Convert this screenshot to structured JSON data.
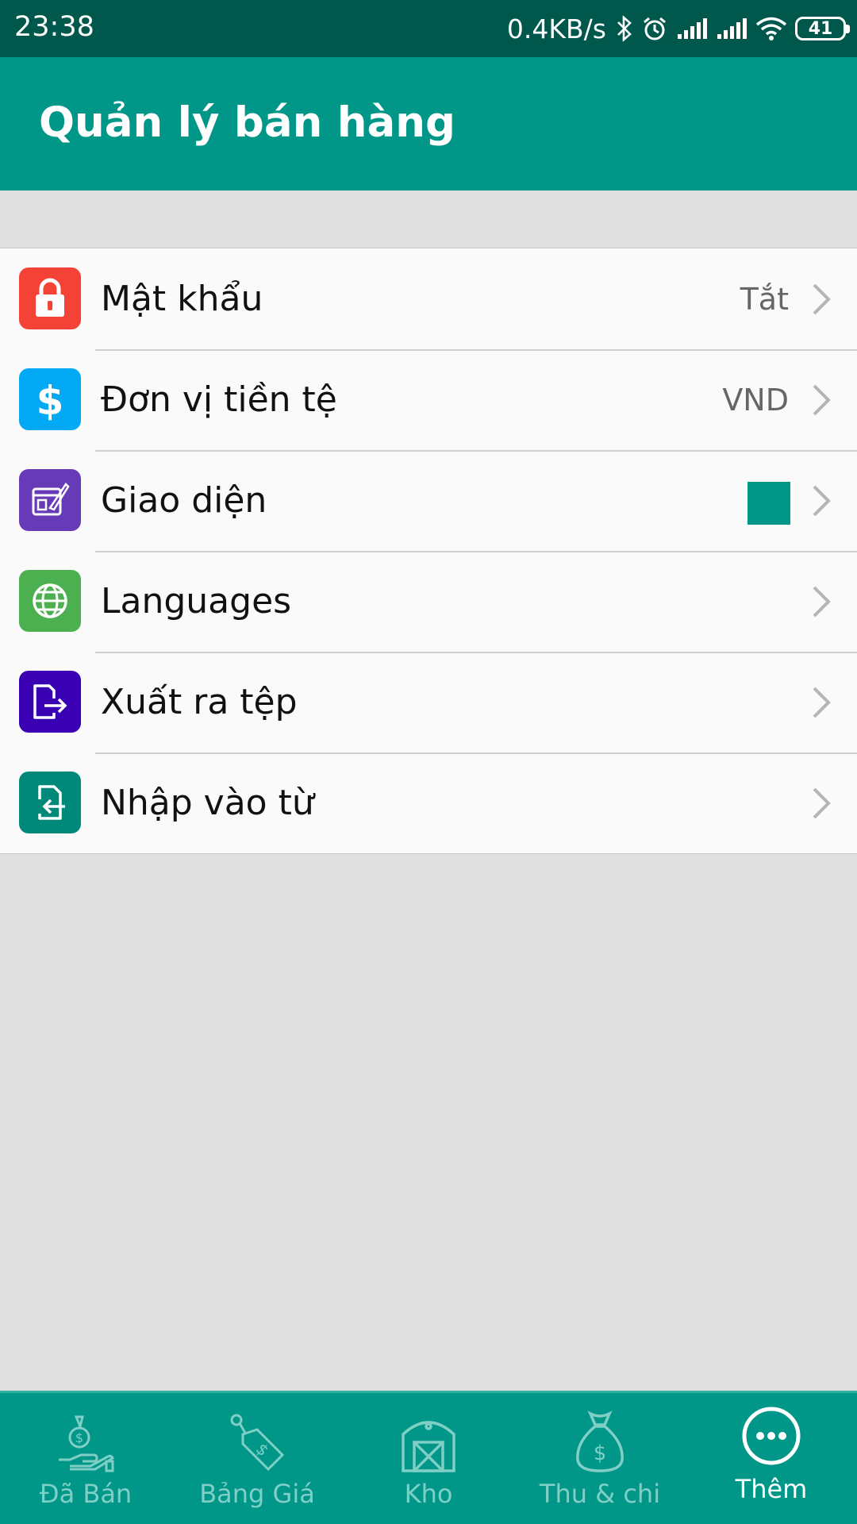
{
  "status_bar": {
    "time": "23:38",
    "net_speed": "0.4KB/s",
    "battery": "41",
    "icons": [
      "bluetooth-icon",
      "alarm-icon",
      "signal-icon",
      "signal-icon",
      "wifi-icon",
      "battery-icon"
    ]
  },
  "app_bar": {
    "title": "Quản lý bán hàng"
  },
  "settings": [
    {
      "label": "Mật khẩu",
      "value": "Tắt",
      "icon": "lock-icon",
      "icon_bg": "#f44336"
    },
    {
      "label": "Đơn vị tiền tệ",
      "value": "VND",
      "icon": "dollar-icon",
      "icon_bg": "#03a9f4"
    },
    {
      "label": "Giao diện",
      "value": "",
      "icon": "palette-icon",
      "icon_bg": "#673ab7",
      "swatch_color": "#009688"
    },
    {
      "label": "Languages",
      "value": "",
      "icon": "globe-icon",
      "icon_bg": "#4caf50"
    },
    {
      "label": "Xuất ra tệp",
      "value": "",
      "icon": "file-export-icon",
      "icon_bg": "#3a00b4"
    },
    {
      "label": "Nhập vào từ",
      "value": "",
      "icon": "file-import-icon",
      "icon_bg": "#00897b"
    }
  ],
  "bottom_nav": {
    "active_index": 4,
    "items": [
      {
        "label": "Đã Bán",
        "icon": "sold-money-hand-icon"
      },
      {
        "label": "Bảng Giá",
        "icon": "price-tag-icon"
      },
      {
        "label": "Kho",
        "icon": "warehouse-icon"
      },
      {
        "label": "Thu & chi",
        "icon": "money-bag-icon"
      },
      {
        "label": "Thêm",
        "icon": "more-dots-icon"
      }
    ]
  },
  "colors": {
    "primary": "#009688",
    "primary_dark": "#00574b",
    "background": "#e0e0e0",
    "list_bg": "#fafafa"
  }
}
